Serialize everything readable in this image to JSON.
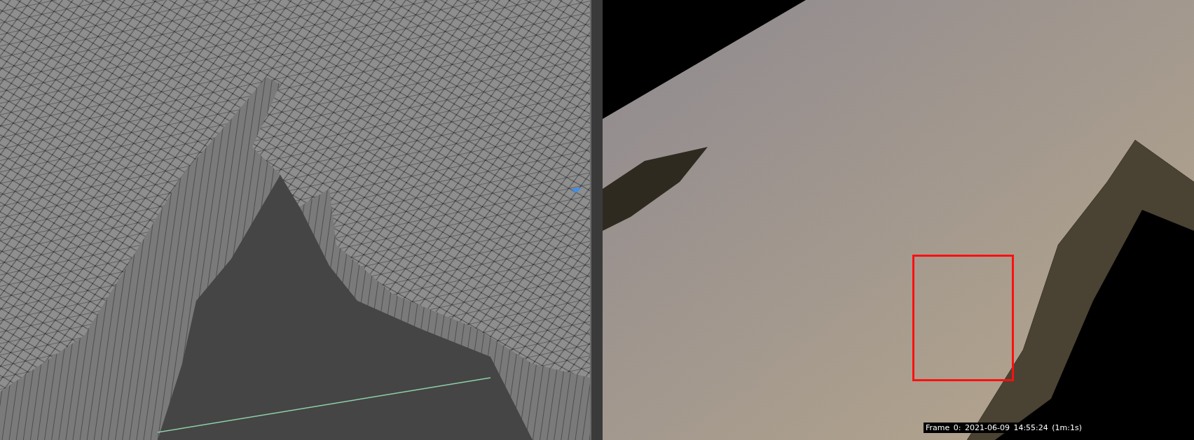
{
  "render_view": {
    "frame_label": "Frame 0: 2021-06-09 14:55:24 (1m:1s)"
  }
}
